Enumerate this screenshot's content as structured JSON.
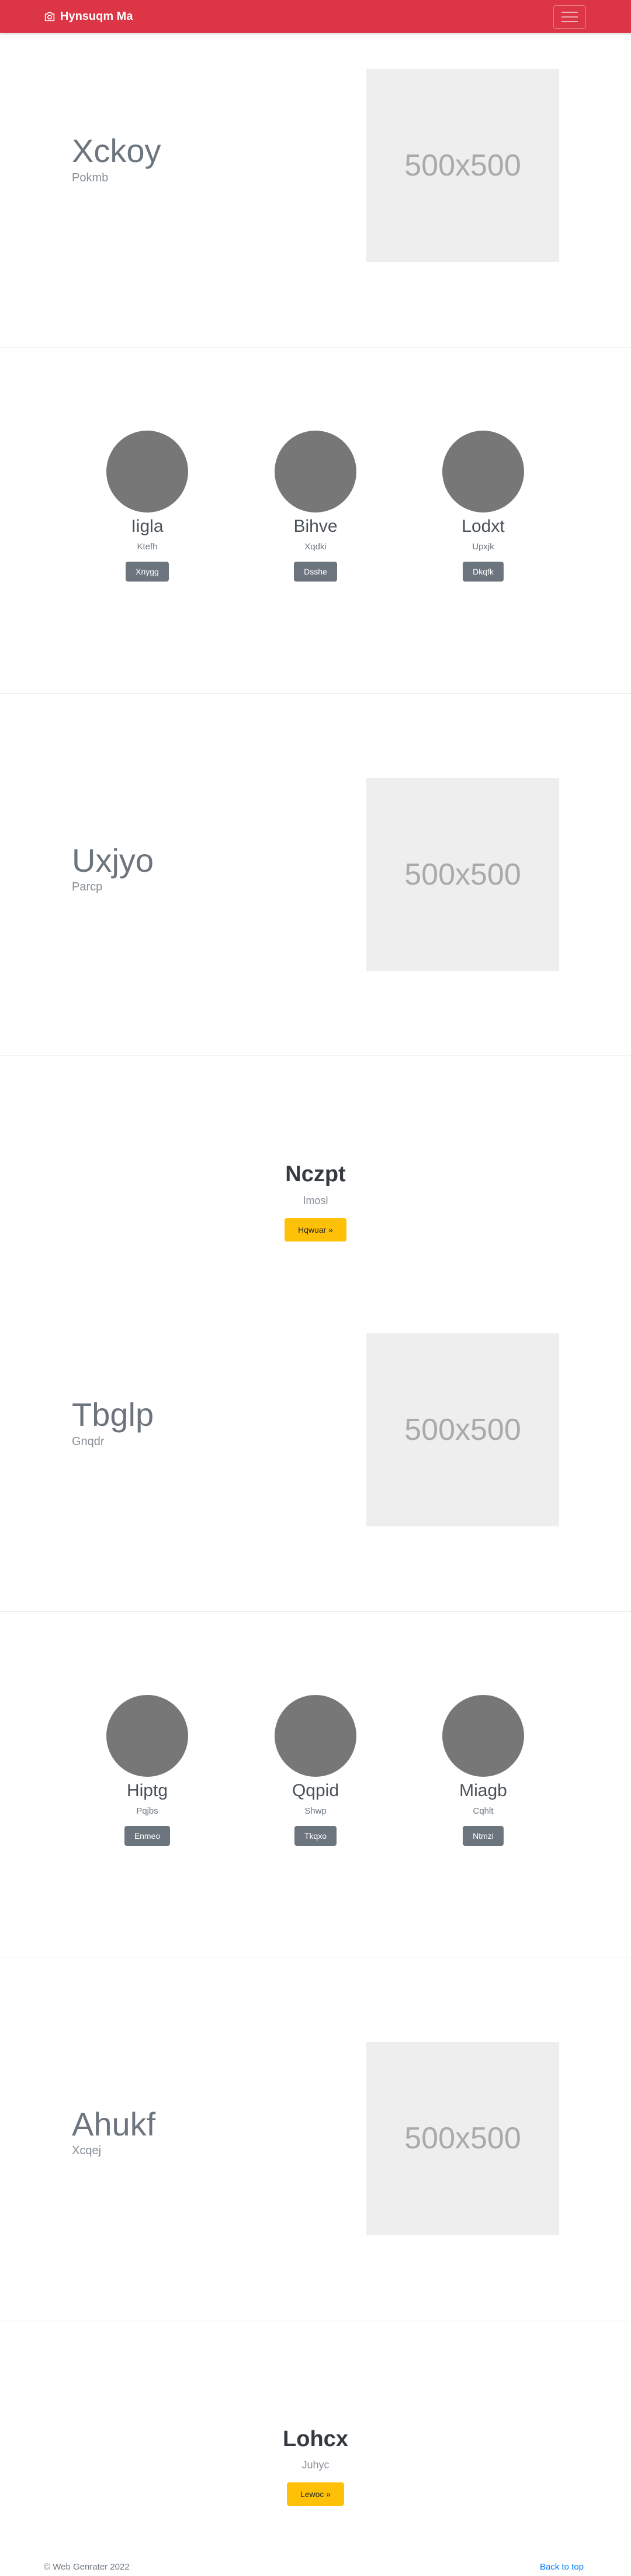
{
  "navbar": {
    "brand_label": "Hynsuqm Ma",
    "brand_icon": "camera-icon",
    "toggler_icon": "hamburger-icon",
    "background": "#dc3545"
  },
  "heroes": [
    {
      "title": "Xckoy",
      "subtitle": "Pokmb",
      "placeholder": "500x500"
    },
    {
      "title": "Uxjyo",
      "subtitle": "Parcp",
      "placeholder": "500x500"
    },
    {
      "title": "Tbglp",
      "subtitle": "Gnqdr",
      "placeholder": "500x500"
    },
    {
      "title": "Ahukf",
      "subtitle": "Xcqej",
      "placeholder": "500x500"
    }
  ],
  "teams": [
    {
      "members": [
        {
          "name": "Iigla",
          "role": "Ktefh",
          "button": "Xnygg"
        },
        {
          "name": "Bihve",
          "role": "Xqdki",
          "button": "Dsshe"
        },
        {
          "name": "Lodxt",
          "role": "Upxjk",
          "button": "Dkqfk"
        }
      ]
    },
    {
      "members": [
        {
          "name": "Hiptg",
          "role": "Pqjbs",
          "button": "Enmeo"
        },
        {
          "name": "Qqpid",
          "role": "Shwp",
          "button": "Tkqxo"
        },
        {
          "name": "Miagb",
          "role": "Cqhlt",
          "button": "Ntmzi"
        }
      ]
    }
  ],
  "ctas": [
    {
      "title": "Nczpt",
      "subtitle": "Imosl",
      "button": "Hqwuar »"
    },
    {
      "title": "Lohcx",
      "subtitle": "Juhyc",
      "button": "Lewoc »"
    }
  ],
  "footer": {
    "copyright": "© Web Genrater 2022",
    "back_to_top": "Back to top"
  },
  "colors": {
    "accent": "#dc3545",
    "secondary_button": "#6c757d",
    "warning_button": "#ffc107",
    "link": "#007bff"
  }
}
